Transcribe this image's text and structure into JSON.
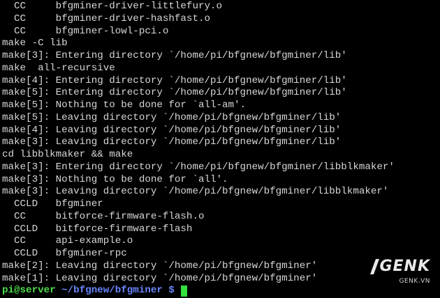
{
  "terminal": {
    "lines": [
      "  CC     bfgminer-driver-littlefury.o",
      "  CC     bfgminer-driver-hashfast.o",
      "  CC     bfgminer-lowl-pci.o",
      "make -C lib",
      "make[3]: Entering directory `/home/pi/bfgnew/bfgminer/lib'",
      "make  all-recursive",
      "make[4]: Entering directory `/home/pi/bfgnew/bfgminer/lib'",
      "make[5]: Entering directory `/home/pi/bfgnew/bfgminer/lib'",
      "make[5]: Nothing to be done for `all-am'.",
      "make[5]: Leaving directory `/home/pi/bfgnew/bfgminer/lib'",
      "make[4]: Leaving directory `/home/pi/bfgnew/bfgminer/lib'",
      "make[3]: Leaving directory `/home/pi/bfgnew/bfgminer/lib'",
      "cd libblkmaker && make",
      "make[3]: Entering directory `/home/pi/bfgnew/bfgminer/libblkmaker'",
      "make[3]: Nothing to be done for `all'.",
      "make[3]: Leaving directory `/home/pi/bfgnew/bfgminer/libblkmaker'",
      "  CCLD   bfgminer",
      "  CC     bitforce-firmware-flash.o",
      "  CCLD   bitforce-firmware-flash",
      "  CC     api-example.o",
      "  CCLD   bfgminer-rpc",
      "make[2]: Leaving directory `/home/pi/bfgnew/bfgminer'",
      "make[1]: Leaving directory `/home/pi/bfgnew/bfgminer'"
    ],
    "prompt": {
      "user_host": "pi@server",
      "path": " ~/bfgnew/bfgminer $ "
    }
  },
  "watermark": {
    "logo": "GENK",
    "sub": "GENK.VN"
  },
  "colors": {
    "background": "#000000",
    "text": "#d7d7d7",
    "prompt_user": "#4ede4e",
    "prompt_path": "#6a86ff",
    "cursor": "#34e03a"
  }
}
